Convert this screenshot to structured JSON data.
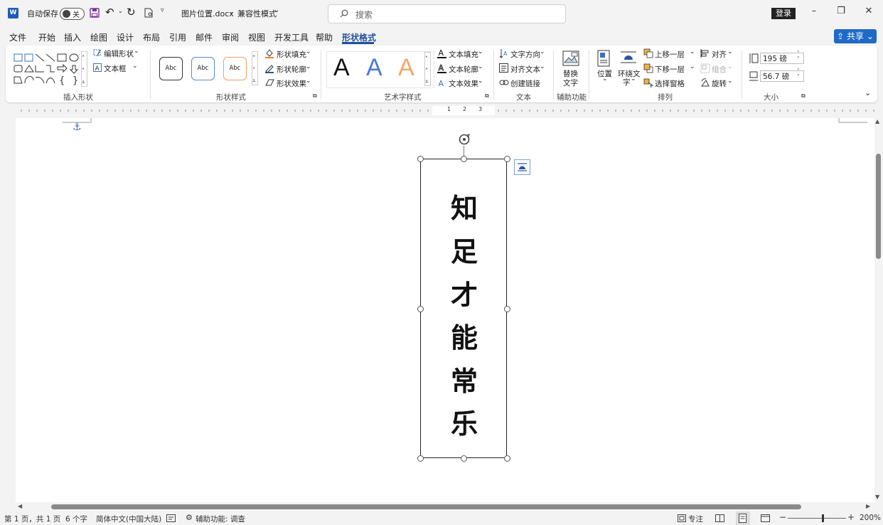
{
  "titlebar": {
    "autosave_label": "自动保存",
    "autosave_state": "关",
    "doc_title": "图片位置.docx",
    "separator": "-",
    "mode": "兼容性模式",
    "search_placeholder": "搜索",
    "login": "登录"
  },
  "menu": {
    "items": [
      "文件",
      "开始",
      "插入",
      "绘图",
      "设计",
      "布局",
      "引用",
      "邮件",
      "审阅",
      "视图",
      "开发工具",
      "帮助",
      "形状格式"
    ],
    "share": "共享"
  },
  "ribbon": {
    "insert_shapes": {
      "label": "插入形状",
      "edit_shape": "编辑形状",
      "text_box": "文本框"
    },
    "shape_styles": {
      "label": "形状样式",
      "abc": "Abc",
      "fill": "形状填充",
      "outline": "形状轮廓",
      "effects": "形状效果"
    },
    "wordart": {
      "label": "艺术字样式",
      "letter": "A",
      "text_fill": "文本填充",
      "text_outline": "文本轮廓",
      "text_effects": "文本效果"
    },
    "text": {
      "label": "文本",
      "direction": "文字方向",
      "align": "对齐文本",
      "link": "创建链接"
    },
    "accessibility": {
      "label": "辅助功能",
      "alt_text_1": "替换",
      "alt_text_2": "文字"
    },
    "arrange": {
      "label": "排列",
      "position": "位置",
      "wrap_1": "环绕文",
      "wrap_2": "字",
      "bring_forward": "上移一层",
      "send_backward": "下移一层",
      "selection_pane": "选择窗格",
      "align": "对齐",
      "group": "组合",
      "rotate": "旋转"
    },
    "size": {
      "label": "大小",
      "height": "195 磅",
      "width": "56.7 磅"
    }
  },
  "ruler": {
    "marks": [
      "1",
      "2",
      "3"
    ]
  },
  "document": {
    "shape_chars": [
      "知",
      "足",
      "才",
      "能",
      "常",
      "乐"
    ]
  },
  "status": {
    "page": "第 1 页，共 1 页",
    "words": "6 个字",
    "language": "简体中文(中国大陆)",
    "accessibility": "辅助功能: 调查",
    "focus": "专注",
    "zoom": "200%"
  },
  "colors": {
    "accent": "#1f4e9e",
    "share_bg": "#1f6ac6",
    "wordart_blue": "#4a7bd0",
    "wordart_orange": "#f0a868"
  }
}
